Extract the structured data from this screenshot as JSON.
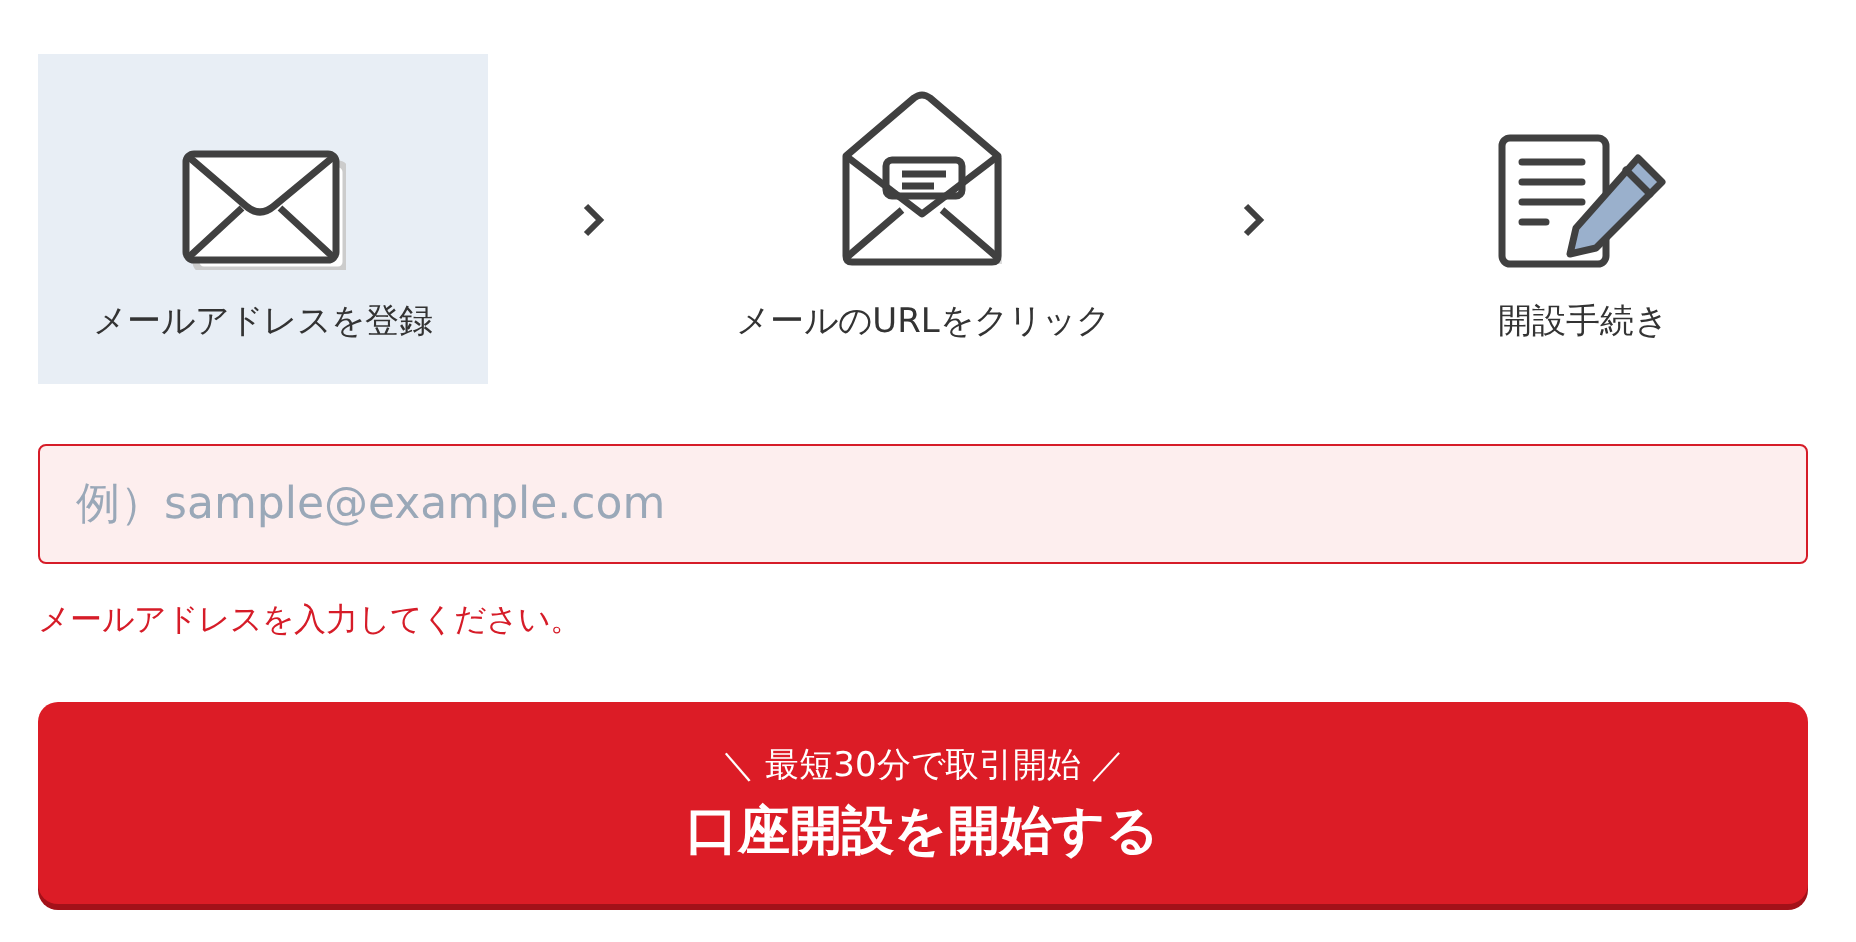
{
  "steps": [
    {
      "label": "メールアドレスを登録",
      "kind": "envelope",
      "selected": true
    },
    {
      "label": "メールのURLをクリック",
      "kind": "open-envelope",
      "selected": false
    },
    {
      "label": "開設手続き",
      "kind": "document",
      "selected": false
    }
  ],
  "email_field": {
    "placeholder": "例）sample@example.com",
    "invalid": true
  },
  "error_message": "メールアドレスを入力してください。",
  "submit_button": {
    "caption": "＼ 最短30分で取引開始 ／",
    "label": "口座開設を開始する"
  }
}
